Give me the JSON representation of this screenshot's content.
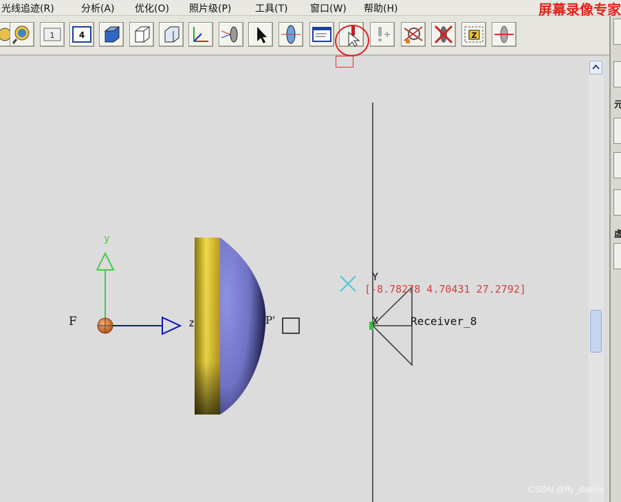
{
  "menu": {
    "items": [
      "光线追迹(R)",
      "分析(A)",
      "优化(O)",
      "照片级(P)",
      "工具(T)",
      "窗口(W)",
      "帮助(H)"
    ],
    "watermark": "屏幕录像专家"
  },
  "toolbar": {
    "buttons": [
      {
        "icon": "zoom-icon"
      },
      {
        "icon": "navigate-icon"
      },
      {
        "icon": "single-view-icon",
        "label": "1"
      },
      {
        "icon": "four-view-icon",
        "label": "4"
      },
      {
        "icon": "solid-cube-icon"
      },
      {
        "icon": "wireframe-cube-icon"
      },
      {
        "icon": "outline-cube-icon"
      },
      {
        "icon": "axes-icon"
      },
      {
        "icon": "render-lens-icon"
      },
      {
        "icon": "select-pointer-icon"
      },
      {
        "icon": "lens-element-icon"
      },
      {
        "icon": "properties-window-icon"
      },
      {
        "icon": "red-marker-icon"
      },
      {
        "icon": "add-marker-icon"
      },
      {
        "icon": "trace-rays-icon"
      },
      {
        "icon": "delete-rays-icon"
      },
      {
        "icon": "z-focus-icon",
        "label": "Z"
      },
      {
        "icon": "lens-rays-icon"
      }
    ]
  },
  "right_panel": {
    "labels": [
      "元",
      "虚"
    ]
  },
  "canvas": {
    "labels": {
      "axis_y": "y",
      "axis_z": "z",
      "focus_label": "F",
      "p_label": "P'",
      "receiver_y": "Y",
      "receiver_x": "X",
      "coordinates": "[-8.78278 4.70431 27.2792]",
      "receiver_name": "Receiver_8"
    },
    "colors": {
      "coordinates_text": "#d04040",
      "axis_y": "#44cc44",
      "axis_z": "#1010c0",
      "lens_gold": "#d9c030",
      "lens_blue": "#7b7fd2",
      "cross_marker": "#48c8d8"
    }
  },
  "watermark": "CSDN @fly_daerm"
}
